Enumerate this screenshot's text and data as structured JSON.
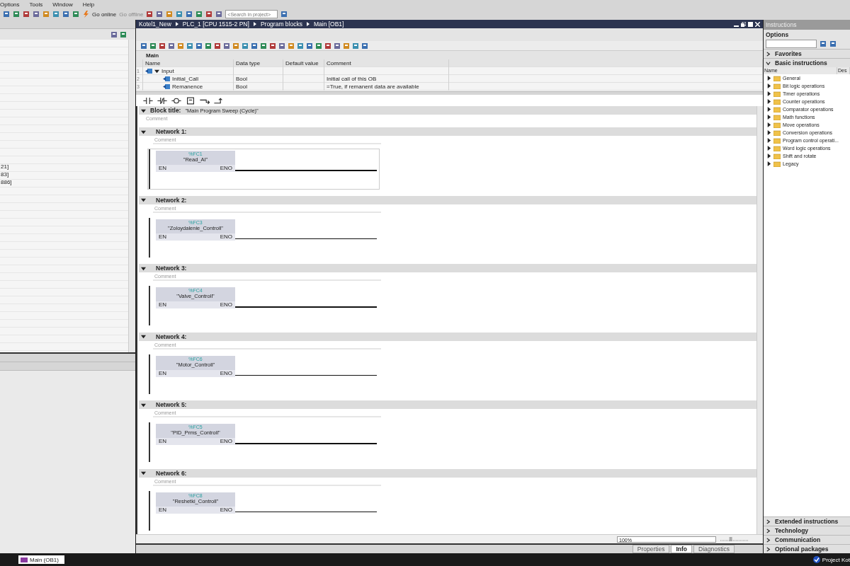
{
  "menu": [
    "Options",
    "Tools",
    "Window",
    "Help"
  ],
  "toolbar": {
    "go_online": "Go online",
    "go_offline": "Go offline",
    "search_placeholder": "<Search in project>"
  },
  "project_tree": {
    "rows": [
      "21]",
      "83]",
      "886]"
    ]
  },
  "editor": {
    "breadcrumb": [
      "Kotel1_New",
      "PLC_1 [CPU 1515-2 PN]",
      "Program blocks",
      "Main [OB1]"
    ],
    "block_name": "Main",
    "interface": {
      "columns": [
        "Name",
        "Data type",
        "Default value",
        "Comment"
      ],
      "rows": [
        {
          "index": "1",
          "name": "Input",
          "expanded": true,
          "children": [
            {
              "index": "2",
              "name": "Initial_Call",
              "data_type": "Bool",
              "comment": "Initial call of this OB"
            },
            {
              "index": "3",
              "name": "Remanence",
              "data_type": "Bool",
              "comment": "=True, if remanent data are available"
            }
          ]
        }
      ]
    },
    "block_title": {
      "label": "Block title:",
      "value": "\"Main Program Sweep (Cycle)\"",
      "comment": "Comment",
      "expanded": true
    },
    "networks": [
      {
        "title": "Network 1:",
        "comment": "Comment",
        "address": "%FC1",
        "block": "\"Read_AI\"",
        "en": "EN",
        "eno": "ENO",
        "expanded": true,
        "selected": true
      },
      {
        "title": "Network 2:",
        "comment": "Comment",
        "address": "%FC3",
        "block": "\"Zoloydalenie_Controll\"",
        "en": "EN",
        "eno": "ENO",
        "expanded": true,
        "selected": false
      },
      {
        "title": "Network 3:",
        "comment": "Comment",
        "address": "%FC4",
        "block": "\"Valve_Controll\"",
        "en": "EN",
        "eno": "ENO",
        "expanded": true,
        "selected": false
      },
      {
        "title": "Network 4:",
        "comment": "Comment",
        "address": "%FC6",
        "block": "\"Motor_Controll\"",
        "en": "EN",
        "eno": "ENO",
        "expanded": true,
        "selected": false
      },
      {
        "title": "Network 5:",
        "comment": "Comment",
        "address": "%FC5",
        "block": "\"PID_Prms_Controll\"",
        "en": "EN",
        "eno": "ENO",
        "expanded": true,
        "selected": false
      },
      {
        "title": "Network 6:",
        "comment": "Comment",
        "address": "%FC8",
        "block": "\"Reshetki_Controll\"",
        "en": "EN",
        "eno": "ENO",
        "expanded": true,
        "selected": false
      }
    ],
    "zoom": "100%",
    "zoom_slider": {
      "level": 0.35
    }
  },
  "bottom_tabs": [
    {
      "label": "Properties",
      "selected": false
    },
    {
      "label": "Info",
      "selected": true
    },
    {
      "label": "Diagnostics",
      "selected": false
    }
  ],
  "instructions": {
    "title": "Instructions",
    "options": "Options",
    "sections_top": [
      {
        "label": "Favorites",
        "expanded": false
      },
      {
        "label": "Basic instructions",
        "expanded": true
      }
    ],
    "columns": [
      "Name",
      "Des"
    ],
    "items": [
      "General",
      "Bit logic operations",
      "Timer operations",
      "Counter operations",
      "Comparator operations",
      "Math functions",
      "Move operations",
      "Conversion operations",
      "Program control operati...",
      "Word logic operations",
      "Shift and rotate",
      "Legacy"
    ],
    "sections_bottom": [
      {
        "label": "Extended instructions",
        "expanded": false
      },
      {
        "label": "Technology",
        "expanded": false
      },
      {
        "label": "Communication",
        "expanded": false
      },
      {
        "label": "Optional packages",
        "expanded": false
      }
    ]
  },
  "taskbar": {
    "tab": "Main (OB1)",
    "status": "Project Kot"
  }
}
